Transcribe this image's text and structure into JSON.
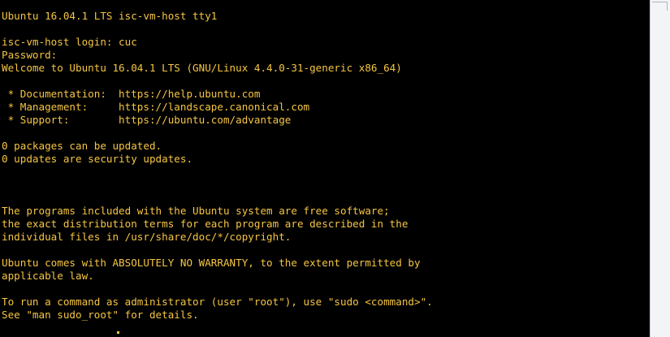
{
  "terminal": {
    "text_color": "#f5c542",
    "background_color": "#000000",
    "lines": [
      "Ubuntu 16.04.1 LTS isc-vm-host tty1",
      "",
      "isc-vm-host login: cuc",
      "Password:",
      "Welcome to Ubuntu 16.04.1 LTS (GNU/Linux 4.4.0-31-generic x86_64)",
      "",
      " * Documentation:  https://help.ubuntu.com",
      " * Management:     https://landscape.canonical.com",
      " * Support:        https://ubuntu.com/advantage",
      "",
      "0 packages can be updated.",
      "0 updates are security updates.",
      "",
      "",
      "",
      "The programs included with the Ubuntu system are free software;",
      "the exact distribution terms for each program are described in the",
      "individual files in /usr/share/doc/*/copyright.",
      "",
      "Ubuntu comes with ABSOLUTELY NO WARRANTY, to the extent permitted by",
      "applicable law.",
      "",
      "To run a command as administrator (user \"root\"), use \"sudo <command>\".",
      "See \"man sudo_root\" for details."
    ]
  }
}
